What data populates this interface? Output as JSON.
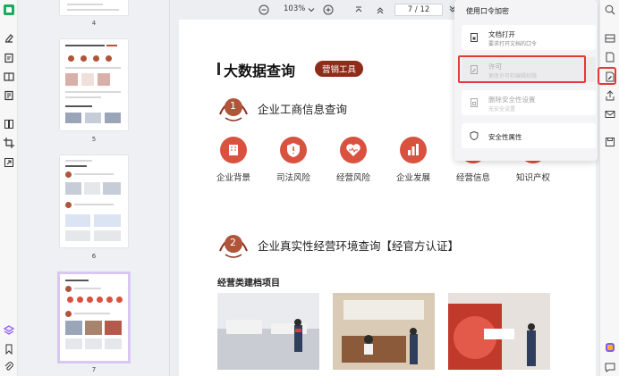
{
  "toolbar": {
    "zoom": "103%",
    "page_current": "7",
    "page_sep": "/",
    "page_total": "12"
  },
  "thumbnails": [
    {
      "page": "4"
    },
    {
      "page": "5"
    },
    {
      "page": "6"
    },
    {
      "page": "7",
      "selected": true
    }
  ],
  "document": {
    "title": "大数据查询",
    "tag": "营销工具",
    "section1": {
      "number": "1",
      "title": "企业工商信息查询"
    },
    "categories": [
      "企业背景",
      "司法风险",
      "经营风险",
      "企业发展",
      "经营信息",
      "知识产权"
    ],
    "section2": {
      "number": "2",
      "title": "企业真实性经营环境查询【经官方认证】"
    },
    "subhead": "经营类建档项目"
  },
  "menu": {
    "title": "使用口令加密",
    "items": [
      {
        "label": "文档打开",
        "sub": "要求打开文档的口令",
        "icon": "doc-lock-icon",
        "disabled": false
      },
      {
        "label": "许可",
        "sub": "更改许可和编辑权限",
        "icon": "doc-edit-icon",
        "disabled": true
      },
      {
        "label": "删除安全性设置",
        "sub": "无安全设置",
        "icon": "doc-unlock-icon",
        "disabled": true
      },
      {
        "label": "安全性属性",
        "sub": "",
        "icon": "shield-icon",
        "disabled": false
      }
    ]
  },
  "colors": {
    "accent": "#d9523f",
    "brand_dark": "#8e2c1a",
    "highlight": "#e53935",
    "logo_green": "#1aad5b"
  }
}
